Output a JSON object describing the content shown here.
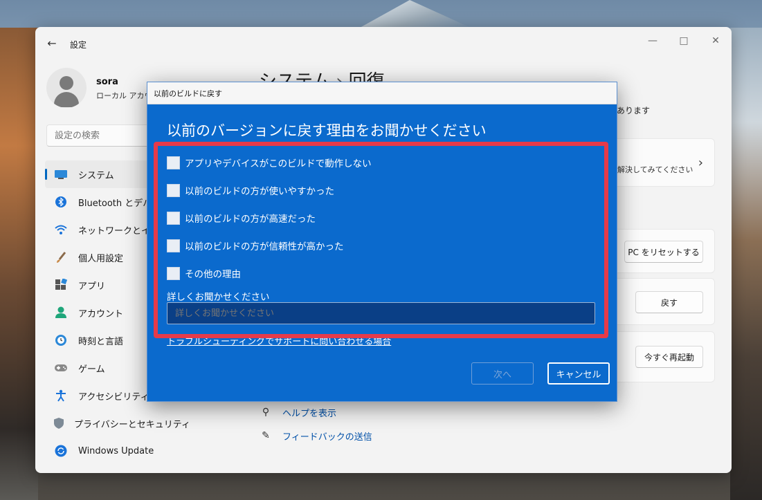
{
  "settings": {
    "app_title": "設定",
    "profile": {
      "name": "sora",
      "account_type": "ローカル アカウン"
    },
    "search": {
      "placeholder": "設定の検索"
    },
    "nav": [
      {
        "label": "システム",
        "icon": "monitor-icon",
        "name": "nav-item-system"
      },
      {
        "label": "Bluetooth とデバイ",
        "icon": "bluetooth-icon",
        "name": "nav-item-bluetooth"
      },
      {
        "label": "ネットワークとインタ",
        "icon": "wifi-icon",
        "name": "nav-item-network"
      },
      {
        "label": "個人用設定",
        "icon": "brush-icon",
        "name": "nav-item-personalization"
      },
      {
        "label": "アプリ",
        "icon": "apps-icon",
        "name": "nav-item-apps"
      },
      {
        "label": "アカウント",
        "icon": "person-icon",
        "name": "nav-item-accounts"
      },
      {
        "label": "時刻と言語",
        "icon": "clock-globe-icon",
        "name": "nav-item-time-language"
      },
      {
        "label": "ゲーム",
        "icon": "gamepad-icon",
        "name": "nav-item-gaming"
      },
      {
        "label": "アクセシビリティ",
        "icon": "accessibility-icon",
        "name": "nav-item-accessibility"
      },
      {
        "label": "プライバシーとセキュリティ",
        "icon": "shield-icon",
        "name": "nav-item-privacy"
      },
      {
        "label": "Windows Update",
        "icon": "update-icon",
        "name": "nav-item-windows-update"
      }
    ],
    "breadcrumb": {
      "parent": "システム",
      "separator": "›",
      "current": "回復"
    },
    "description_tail": "あります",
    "troubleshoot_card_text": "解決してみてください",
    "buttons": {
      "reset": "PC をリセットする",
      "go_back": "戻す",
      "restart": "今すぐ再起動"
    },
    "links": {
      "help": "ヘルプを表示",
      "feedback": "フィードバックの送信"
    }
  },
  "dialog": {
    "title": "以前のビルドに戻す",
    "heading": "以前のバージョンに戻す理由をお聞かせください",
    "options": [
      "アプリやデバイスがこのビルドで動作しない",
      "以前のビルドの方が使いやすかった",
      "以前のビルドの方が高速だった",
      "以前のビルドの方が信頼性が高かった",
      "その他の理由"
    ],
    "details_label": "詳しくお聞かせください",
    "details_placeholder": "詳しくお聞かせください",
    "troubleshoot_link": "トラブルシューティングでサポートに問い合わせる場合",
    "next_button": "次へ",
    "cancel_button": "キャンセル"
  },
  "colors": {
    "accent": "#0067c0",
    "dialog_bg": "#0b6acd",
    "highlight": "#e63a4a"
  }
}
